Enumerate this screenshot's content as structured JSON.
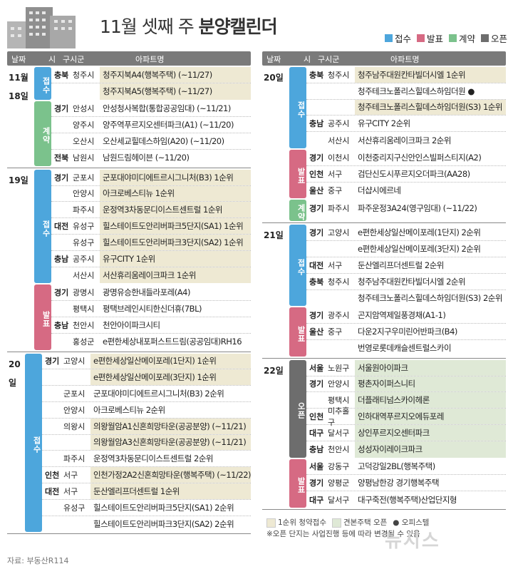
{
  "header": {
    "title_prefix": "11월 셋째 주",
    "title_bold": "분양캘린더"
  },
  "legend": [
    {
      "label": "접수",
      "color": "#4da6dc"
    },
    {
      "label": "발표",
      "color": "#d66a83"
    },
    {
      "label": "계약",
      "color": "#7bc28c"
    },
    {
      "label": "오픈",
      "color": "#6d6d6d"
    }
  ],
  "colhead": {
    "date": "날짜",
    "city": "시",
    "district": "구시군",
    "apt": "아파트명"
  },
  "columns": [
    {
      "groups": [
        {
          "date": "11월 18일",
          "subs": [
            {
              "cat": "접수",
              "color": "#4da6dc",
              "rows": [
                {
                  "p": "충북",
                  "c": "청주시",
                  "a": "청주지북A4(행복주택) (~11/27)",
                  "hl": "yellow"
                },
                {
                  "p": "",
                  "c": "",
                  "a": "청주지북A5(행복주택) (~11/27)",
                  "hl": "yellow"
                }
              ]
            },
            {
              "cat": "계약",
              "color": "#7bc28c",
              "rows": [
                {
                  "p": "경기",
                  "c": "안성시",
                  "a": "안성청사복합(통합공공임대) (~11/21)",
                  "hl": ""
                },
                {
                  "p": "",
                  "c": "양주시",
                  "a": "양주역푸르지오센터파크(A1) (~11/20)",
                  "hl": ""
                },
                {
                  "p": "",
                  "c": "오산시",
                  "a": "오산세교힐데스하임(A20) (~11/20)",
                  "hl": ""
                },
                {
                  "p": "전북",
                  "c": "남원시",
                  "a": "남원드림헤이븐 (~11/20)",
                  "hl": ""
                }
              ]
            }
          ]
        },
        {
          "date": "19일",
          "subs": [
            {
              "cat": "접수",
              "color": "#4da6dc",
              "rows": [
                {
                  "p": "경기",
                  "c": "군포시",
                  "a": "군포대야미디에트르시그니처(B3) 1순위",
                  "hl": "yellow"
                },
                {
                  "p": "",
                  "c": "안양시",
                  "a": "아크로베스티뉴 1순위",
                  "hl": "yellow"
                },
                {
                  "p": "",
                  "c": "파주시",
                  "a": "운정역3차동문디이스트센트럴 1순위",
                  "hl": "yellow"
                },
                {
                  "p": "대전",
                  "c": "유성구",
                  "a": "힐스테이트도안리버파크5단지(SA1) 1순위",
                  "hl": "yellow"
                },
                {
                  "p": "",
                  "c": "유성구",
                  "a": "힐스테이트도안리버파크3단지(SA2) 1순위",
                  "hl": "yellow"
                },
                {
                  "p": "충남",
                  "c": "공주시",
                  "a": "유구CITY 1순위",
                  "hl": "yellow"
                },
                {
                  "p": "",
                  "c": "서산시",
                  "a": "서산휴리움레이크파크 1순위",
                  "hl": "yellow"
                }
              ]
            },
            {
              "cat": "발표",
              "color": "#d66a83",
              "rows": [
                {
                  "p": "경기",
                  "c": "광명시",
                  "a": "광명유승한내들라포레(A4)",
                  "hl": ""
                },
                {
                  "p": "",
                  "c": "평택시",
                  "a": "평택브레인시티한신더휴(7BL)",
                  "hl": ""
                },
                {
                  "p": "충남",
                  "c": "천안시",
                  "a": "천안아이파크시티",
                  "hl": ""
                },
                {
                  "p": "",
                  "c": "홍성군",
                  "a": "e편한세상내포퍼스트드림(공공임대)RH16",
                  "hl": ""
                }
              ]
            }
          ]
        },
        {
          "date": "20일",
          "subs": [
            {
              "cat": "접수",
              "color": "#4da6dc",
              "rows": [
                {
                  "p": "경기",
                  "c": "고양시",
                  "a": "e편한세상일산메이포레(1단지) 1순위",
                  "hl": "yellow"
                },
                {
                  "p": "",
                  "c": "",
                  "a": "e편한세상일산메이포레(3단지) 1순위",
                  "hl": "yellow"
                },
                {
                  "p": "",
                  "c": "군포시",
                  "a": "군포대야미디에트르시그니처(B3) 2순위",
                  "hl": ""
                },
                {
                  "p": "",
                  "c": "안양시",
                  "a": "아크로베스티뉴 2순위",
                  "hl": ""
                },
                {
                  "p": "",
                  "c": "의왕시",
                  "a": "의왕월암A1신혼희망타운(공공분양) (~11/21)",
                  "hl": "yellow"
                },
                {
                  "p": "",
                  "c": "",
                  "a": "의왕월암A3신혼희망타운(공공분양) (~11/21)",
                  "hl": "yellow"
                },
                {
                  "p": "",
                  "c": "파주시",
                  "a": "운정역3차동문디이스트센트럴 2순위",
                  "hl": ""
                },
                {
                  "p": "인천",
                  "c": "서구",
                  "a": "인천가정2A2신혼희망타운(행복주택) (~11/22)",
                  "hl": "yellow"
                },
                {
                  "p": "대전",
                  "c": "서구",
                  "a": "둔산엘리프더센트럴 1순위",
                  "hl": "yellow"
                },
                {
                  "p": "",
                  "c": "유성구",
                  "a": "힐스테이트도안리버파크5단지(SA1) 2순위",
                  "hl": ""
                },
                {
                  "p": "",
                  "c": "",
                  "a": "힐스테이트도안리버파크3단지(SA2) 2순위",
                  "hl": ""
                }
              ]
            }
          ]
        }
      ]
    },
    {
      "groups": [
        {
          "date": "20일",
          "subs": [
            {
              "cat": "접수",
              "color": "#4da6dc",
              "rows": [
                {
                  "p": "충북",
                  "c": "청주시",
                  "a": "청주남주대원칸타빌더시엘 1순위",
                  "hl": "yellow"
                },
                {
                  "p": "",
                  "c": "",
                  "a": "청주테크노폴리스힐데스하임더원 ●",
                  "hl": ""
                },
                {
                  "p": "",
                  "c": "",
                  "a": "청주테크노폴리스힐데스하임더원(S3) 1순위",
                  "hl": "yellow"
                },
                {
                  "p": "충남",
                  "c": "공주시",
                  "a": "유구CITY 2순위",
                  "hl": ""
                },
                {
                  "p": "",
                  "c": "서산시",
                  "a": "서산휴리움레이크파크 2순위",
                  "hl": ""
                }
              ]
            },
            {
              "cat": "발표",
              "color": "#d66a83",
              "rows": [
                {
                  "p": "경기",
                  "c": "이천시",
                  "a": "이천중리지구신안인스빌퍼스티지(A2)",
                  "hl": ""
                },
                {
                  "p": "인천",
                  "c": "서구",
                  "a": "검단신도시푸르지오더파크(AA28)",
                  "hl": ""
                },
                {
                  "p": "울산",
                  "c": "중구",
                  "a": "더샵시에르네",
                  "hl": ""
                }
              ]
            },
            {
              "cat": "계약",
              "color": "#7bc28c",
              "rows": [
                {
                  "p": "경기",
                  "c": "파주시",
                  "a": "파주운정3A24(영구임대) (~11/22)",
                  "hl": ""
                }
              ]
            }
          ]
        },
        {
          "date": "21일",
          "subs": [
            {
              "cat": "접수",
              "color": "#4da6dc",
              "rows": [
                {
                  "p": "경기",
                  "c": "고양시",
                  "a": "e편한세상일산메이포레(1단지) 2순위",
                  "hl": ""
                },
                {
                  "p": "",
                  "c": "",
                  "a": "e편한세상일산메이포레(3단지) 2순위",
                  "hl": ""
                },
                {
                  "p": "대전",
                  "c": "서구",
                  "a": "둔산엘리프더센트럴 2순위",
                  "hl": ""
                },
                {
                  "p": "충북",
                  "c": "청주시",
                  "a": "청주남주대원칸타빌더시엘 2순위",
                  "hl": ""
                },
                {
                  "p": "",
                  "c": "",
                  "a": "청주테크노폴리스힐데스하임더원(S3) 2순위",
                  "hl": ""
                }
              ]
            },
            {
              "cat": "발표",
              "color": "#d66a83",
              "rows": [
                {
                  "p": "경기",
                  "c": "광주시",
                  "a": "곤지암역제일풍경채(A1-1)",
                  "hl": ""
                },
                {
                  "p": "울산",
                  "c": "중구",
                  "a": "다운2지구우미린어반파크(B4)",
                  "hl": ""
                },
                {
                  "p": "",
                  "c": "",
                  "a": "번영로롯데캐슬센트럴스카이",
                  "hl": ""
                }
              ]
            }
          ]
        },
        {
          "date": "22일",
          "subs": [
            {
              "cat": "오픈",
              "color": "#6d6d6d",
              "rows": [
                {
                  "p": "서울",
                  "c": "노원구",
                  "a": "서울원아이파크",
                  "hl": "green"
                },
                {
                  "p": "경기",
                  "c": "안양시",
                  "a": "평촌자이퍼스니티",
                  "hl": "green"
                },
                {
                  "p": "",
                  "c": "평택시",
                  "a": "더플래티넘스카이헤론",
                  "hl": "green"
                },
                {
                  "p": "인천",
                  "c": "미추홀구",
                  "a": "인하대역푸르지오에듀포레",
                  "hl": "green"
                },
                {
                  "p": "대구",
                  "c": "달서구",
                  "a": "상인푸르지오센터파크",
                  "hl": "green"
                },
                {
                  "p": "충남",
                  "c": "천안시",
                  "a": "성성자이레이크파크",
                  "hl": "green"
                }
              ]
            },
            {
              "cat": "발표",
              "color": "#d66a83",
              "rows": [
                {
                  "p": "서울",
                  "c": "강동구",
                  "a": "고덕강일2BL(행복주택)",
                  "hl": ""
                },
                {
                  "p": "경기",
                  "c": "양평군",
                  "a": "양평남한강 경기행복주택",
                  "hl": ""
                },
                {
                  "p": "대구",
                  "c": "달서구",
                  "a": "대구죽전(행복주택)산업단지형",
                  "hl": ""
                }
              ]
            }
          ]
        }
      ]
    }
  ],
  "footnote": {
    "legend_items": [
      {
        "label": "1순위 청약접수",
        "color": "#eee9d3"
      },
      {
        "label": "견본주택 오픈",
        "color": "#dfe9d6"
      },
      {
        "label": "● 오피스텔",
        "color": ""
      }
    ],
    "note": "※오픈 단지는 사업진행 등에 따라 변경될 수 있음"
  },
  "source": "자료: 부동산R114",
  "watermark": "뉴시스"
}
